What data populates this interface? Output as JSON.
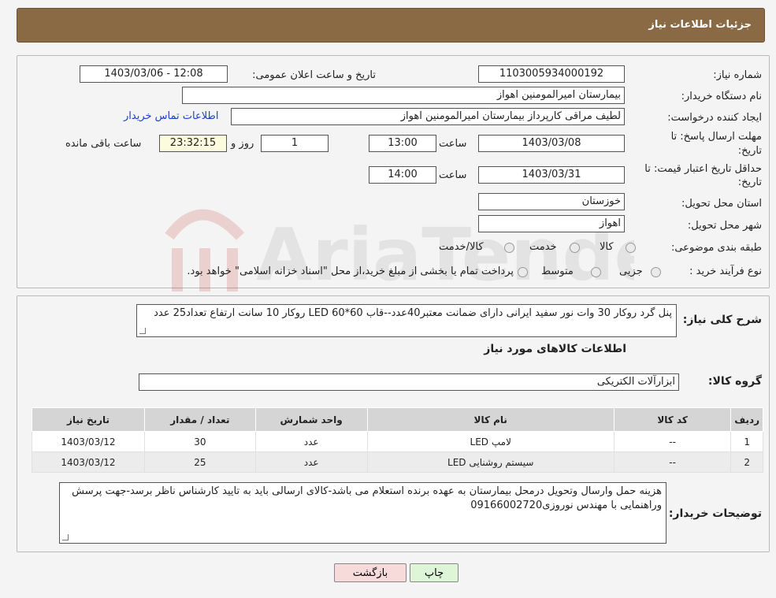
{
  "header": {
    "title": "جزئیات اطلاعات نیاز"
  },
  "form": {
    "need_number_label": "شماره نیاز:",
    "need_number": "1103005934000192",
    "announce_label": "تاریخ و ساعت اعلان عمومی:",
    "announce_value": "1403/03/06 - 12:08",
    "buyer_label": "نام دستگاه خریدار:",
    "buyer_value": "بیمارستان امیرالمومنین اهواز",
    "creator_label": "ایجاد کننده درخواست:",
    "creator_value": "لطیف مراقی کارپرداز بیمارستان امیرالمومنین اهواز",
    "contact_link": "اطلاعات تماس خریدار",
    "deadline_label_1": "مهلت ارسال پاسخ: تا",
    "deadline_label_2": "تاریخ:",
    "deadline_date": "1403/03/08",
    "time_label": "ساعت",
    "deadline_time": "13:00",
    "days_value": "1",
    "days_label": "روز و",
    "remaining_time": "23:32:15",
    "remaining_label": "ساعت باقی مانده",
    "validity_label_1": "حداقل تاریخ اعتبار قیمت: تا",
    "validity_label_2": "تاریخ:",
    "validity_date": "1403/03/31",
    "validity_time": "14:00",
    "province_label": "استان محل تحویل:",
    "province_value": "خوزستان",
    "city_label": "شهر محل تحویل:",
    "city_value": "اهواز",
    "category_label": "طبقه بندی موضوعی:",
    "category_options": [
      "کالا",
      "خدمت",
      "کالا/خدمت"
    ],
    "process_label": "نوع فرآیند خرید :",
    "process_options": [
      "جزیی",
      "متوسط"
    ],
    "process_note": "پرداخت تمام یا بخشی از مبلغ خرید،از محل \"اسناد خزانه اسلامی\" خواهد بود."
  },
  "summary": {
    "label": "شرح کلی نیاز:",
    "text": "پنل گرد روکار 30 وات نور سفید ایرانی  دارای ضمانت معتبر40عدد--قاب 60*60 LED  روکار 10 سانت ارتفاع تعداد25 عدد"
  },
  "goods_info_title": "اطلاعات کالاهای مورد نیاز",
  "goods_group": {
    "label": "گروه کالا:",
    "value": "ابزارآلات الکتریکی"
  },
  "table": {
    "headers": [
      "ردیف",
      "کد کالا",
      "نام کالا",
      "واحد شمارش",
      "تعداد / مقدار",
      "تاریخ نیاز"
    ],
    "rows": [
      [
        "1",
        "--",
        "لامپ LED",
        "عدد",
        "30",
        "1403/03/12"
      ],
      [
        "2",
        "--",
        "سیستم روشنایی LED",
        "عدد",
        "25",
        "1403/03/12"
      ]
    ]
  },
  "buyer_notes": {
    "label": "توضیحات خریدار:",
    "text": "هزینه حمل وارسال وتحویل درمحل بیمارستان به عهده برنده استعلام می باشد-کالای ارسالی باید به تایید کارشناس ناظر برسد-جهت پرسش وراهنمایی با مهندس نوروزی09166002720"
  },
  "buttons": {
    "print": "چاپ",
    "back": "بازگشت"
  },
  "watermark": {
    "text": "AriaTender.neT"
  },
  "colors": {
    "header": "#8a6a45",
    "link": "#1a3fcf",
    "back_button": "#f7dada",
    "print_button": "#dff5d8"
  }
}
